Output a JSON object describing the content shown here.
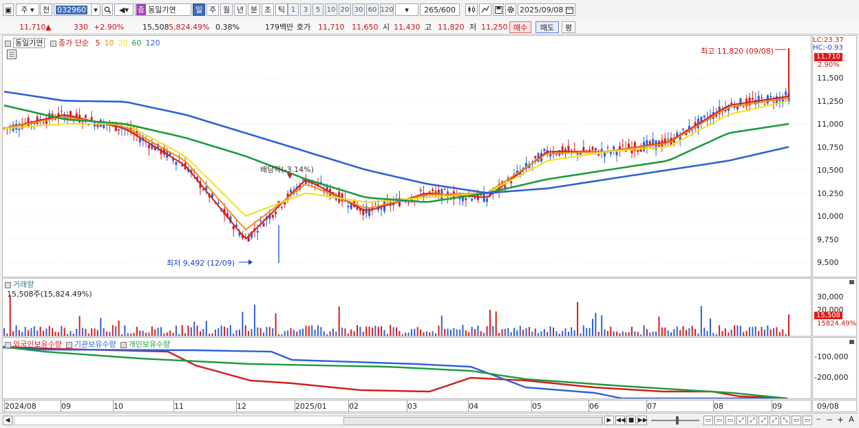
{
  "toolbar": {
    "market": "주",
    "mode": "전",
    "code": "032960",
    "badge": "종",
    "name": "동일기연",
    "periods": [
      "일",
      "주",
      "월",
      "년",
      "분",
      "초",
      "틱"
    ],
    "intervals": [
      "1",
      "3",
      "5",
      "10",
      "20",
      "30",
      "60",
      "120"
    ],
    "count": "265",
    "count_total": "/600",
    "date": "2025/09/08"
  },
  "quote": {
    "price": "11,710",
    "arrow": "▲",
    "change": "330",
    "change_pct": "+2.90%",
    "volume": "15,508",
    "volume_pct": "5,824.49%",
    "turnover_pct": "0.38%",
    "amount": "179백만",
    "ask_label": "호가",
    "ask": "11,710",
    "bid": "11,650",
    "open_label": "시",
    "open": "11,430",
    "high_label": "고",
    "high": "11,820",
    "low_label": "저",
    "low": "11,250",
    "buy": "매수",
    "sell": "매도",
    "eval": "평"
  },
  "legend": {
    "name": "동일기연",
    "ma_title": "종가 단순",
    "ma_periods": [
      "5",
      "10",
      "20",
      "60",
      "120"
    ],
    "ma_colors": [
      "#d41c1c",
      "#f28c1a",
      "#f0e018",
      "#1e9a3c",
      "#2f5fd8"
    ]
  },
  "annotations": {
    "high": "최고 11,820 (09/08)",
    "low": "최저 9,492 (12/09)",
    "dividend": "배당락(-3.14%)"
  },
  "price_axis": {
    "lc": "LC:23.37",
    "hc": "HC:-0.93",
    "last": "11,710",
    "pct": "2.90%",
    "ticks": [
      "11,500",
      "11,250",
      "11,000",
      "10,750",
      "10,500",
      "10,250",
      "10,000",
      "9,750",
      "9,500"
    ]
  },
  "volume": {
    "title": "거래량",
    "info": "15,508주(15,824.49%)",
    "ticks": [
      "30,000",
      "20,000"
    ],
    "last": "15,508",
    "last_pct": "15824.49%"
  },
  "holdings": {
    "labels": [
      "외국인보유수량",
      "기관보유수량",
      "개인보유수량"
    ],
    "colors": [
      "#d41c1c",
      "#2f5fd8",
      "#1e9a3c"
    ],
    "ticks": [
      "-100,000",
      "-200,000"
    ]
  },
  "x_axis": {
    "labels": [
      "2024/08",
      "09",
      "10",
      "11",
      "12",
      "2025/01",
      "02",
      "03",
      "04",
      "05",
      "06",
      "07",
      "08",
      "09"
    ],
    "right": "09/08"
  },
  "chart_data": {
    "type": "line",
    "title": "",
    "x": [
      "2024/08",
      "09",
      "10",
      "11",
      "12",
      "2025/01",
      "02",
      "03",
      "04",
      "05",
      "06",
      "07",
      "08",
      "09"
    ],
    "price_range": [
      9492,
      11820
    ],
    "series": [
      {
        "name": "5",
        "values": [
          10950,
          11100,
          10950,
          10550,
          9750,
          10400,
          10050,
          10250,
          10200,
          10700,
          10700,
          10800,
          11200,
          11300
        ]
      },
      {
        "name": "10",
        "values": [
          10950,
          11080,
          10970,
          10600,
          9850,
          10350,
          10080,
          10230,
          10250,
          10680,
          10700,
          10790,
          11180,
          11280
        ]
      },
      {
        "name": "20",
        "values": [
          10950,
          11000,
          11000,
          10650,
          10000,
          10250,
          10150,
          10200,
          10250,
          10600,
          10700,
          10750,
          11100,
          11250
        ]
      },
      {
        "name": "60",
        "values": [
          11200,
          11050,
          11000,
          10850,
          10650,
          10400,
          10200,
          10150,
          10250,
          10400,
          10500,
          10600,
          10900,
          11000
        ]
      },
      {
        "name": "120",
        "values": [
          11350,
          11250,
          11240,
          11100,
          10900,
          10700,
          10500,
          10350,
          10250,
          10300,
          10400,
          10500,
          10600,
          10750
        ]
      }
    ]
  }
}
